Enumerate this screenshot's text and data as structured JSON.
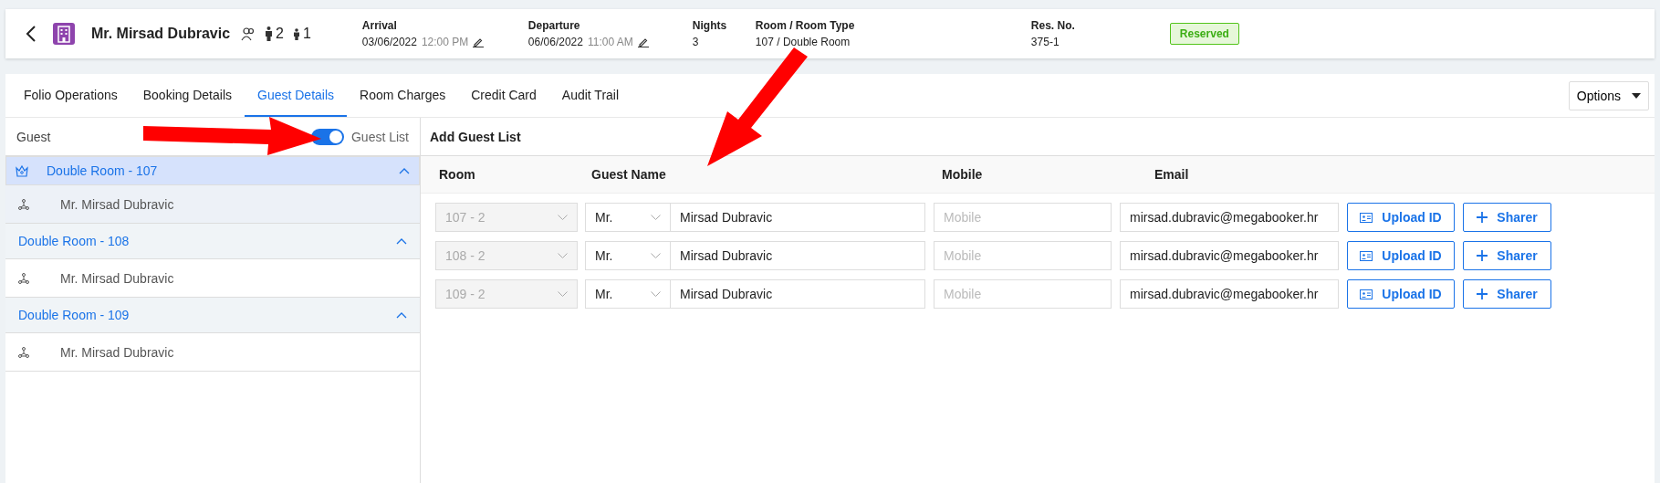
{
  "header": {
    "guest_name": "Mr. Mirsad Dubravic",
    "adults": "2",
    "children": "1",
    "fields": [
      {
        "label": "Arrival",
        "value": "03/06/2022",
        "time": "12:00 PM",
        "editable": true
      },
      {
        "label": "Departure",
        "value": "06/06/2022",
        "time": "11:00 AM",
        "editable": true
      },
      {
        "label": "Nights",
        "value": "3",
        "editable": false
      },
      {
        "label": "Room / Room Type",
        "value": "107 / Double Room",
        "editable": false
      },
      {
        "label": "Res. No.",
        "value": "375-1",
        "editable": false
      }
    ],
    "status": "Reserved"
  },
  "tabs": [
    {
      "label": "Folio Operations",
      "selected": false
    },
    {
      "label": "Booking Details",
      "selected": false
    },
    {
      "label": "Guest Details",
      "selected": true
    },
    {
      "label": "Room Charges",
      "selected": false
    },
    {
      "label": "Credit Card",
      "selected": false
    },
    {
      "label": "Audit Trail",
      "selected": false
    }
  ],
  "options_button": "Options",
  "sidebar": {
    "title": "Guest",
    "toggle_label": "Guest List",
    "toggle_on": true,
    "rooms": [
      {
        "name": "Double Room - 107",
        "selected": true,
        "expanded": true,
        "guests": [
          "Mr. Mirsad Dubravic"
        ]
      },
      {
        "name": "Double Room - 108",
        "selected": false,
        "expanded": true,
        "guests": [
          "Mr. Mirsad Dubravic"
        ]
      },
      {
        "name": "Double Room - 109",
        "selected": false,
        "expanded": true,
        "guests": [
          "Mr. Mirsad Dubravic"
        ]
      }
    ]
  },
  "guest_list": {
    "title": "Add Guest List",
    "columns": [
      "Room",
      "Guest Name",
      "Mobile",
      "Email"
    ],
    "rows": [
      {
        "room": "107 - 2",
        "salutation": "Mr.",
        "name": "Mirsad Dubravic",
        "mobile_placeholder": "Mobile",
        "email": "mirsad.dubravic@megabooker.hr",
        "upload": "Upload ID",
        "sharer": "Sharer"
      },
      {
        "room": "108 - 2",
        "salutation": "Mr.",
        "name": "Mirsad Dubravic",
        "mobile_placeholder": "Mobile",
        "email": "mirsad.dubravic@megabooker.hr",
        "upload": "Upload ID",
        "sharer": "Sharer"
      },
      {
        "room": "109 - 2",
        "salutation": "Mr.",
        "name": "Mirsad Dubravic",
        "mobile_placeholder": "Mobile",
        "email": "mirsad.dubravic@megabooker.hr",
        "upload": "Upload ID",
        "sharer": "Sharer"
      }
    ]
  }
}
